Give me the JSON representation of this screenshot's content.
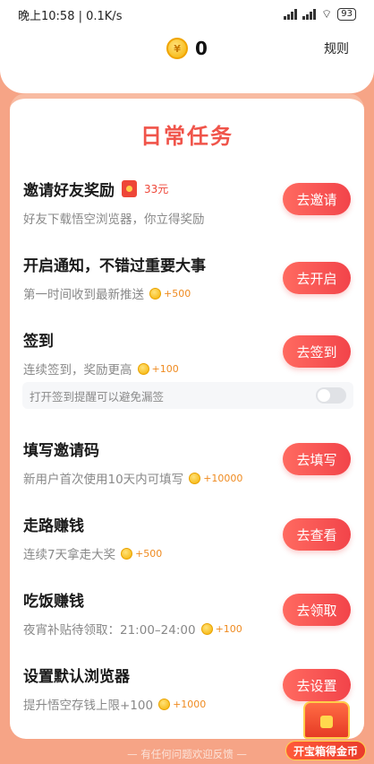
{
  "status_bar": {
    "time_speed": "晚上10:58 | 0.1K/s",
    "battery": "93"
  },
  "header": {
    "balance": "0",
    "coin_icon_glyph": "¥",
    "rules_label": "规则"
  },
  "card": {
    "title": "日常任务"
  },
  "tasks": [
    {
      "title": "邀请好友奖励",
      "reward": "33元",
      "desc": "好友下载悟空浏览器，你立得奖励",
      "button": "去邀请"
    },
    {
      "title": "开启通知，不错过重要大事",
      "desc": "第一时间收到最新推送",
      "reward": "+500",
      "button": "去开启"
    },
    {
      "title": "签到",
      "desc": "连续签到，奖励更高",
      "reward": "+100",
      "button": "去签到"
    },
    {
      "title": "填写邀请码",
      "desc": "新用户首次使用10天内可填写",
      "reward": "+10000",
      "button": "去填写"
    },
    {
      "title": "走路赚钱",
      "desc": "连续7天拿走大奖",
      "reward": "+500",
      "button": "去查看"
    },
    {
      "title": "吃饭赚钱",
      "desc": "夜宵补贴待领取：21:00–24:00",
      "reward": "+100",
      "button": "去领取"
    },
    {
      "title": "设置默认浏览器",
      "desc": "提升悟空存钱上限+100",
      "reward": "+1000",
      "button": "去设置"
    }
  ],
  "signin_reminder": {
    "label": "打开签到提醒可以避免漏签",
    "enabled": false
  },
  "footer": {
    "text": "— 有任何问题欢迎反馈 —"
  },
  "treasure_chest": {
    "label": "开宝箱得金币"
  },
  "colors": {
    "accent": "#f0544a",
    "background": "#f6a486",
    "coin": "#f5b100"
  }
}
